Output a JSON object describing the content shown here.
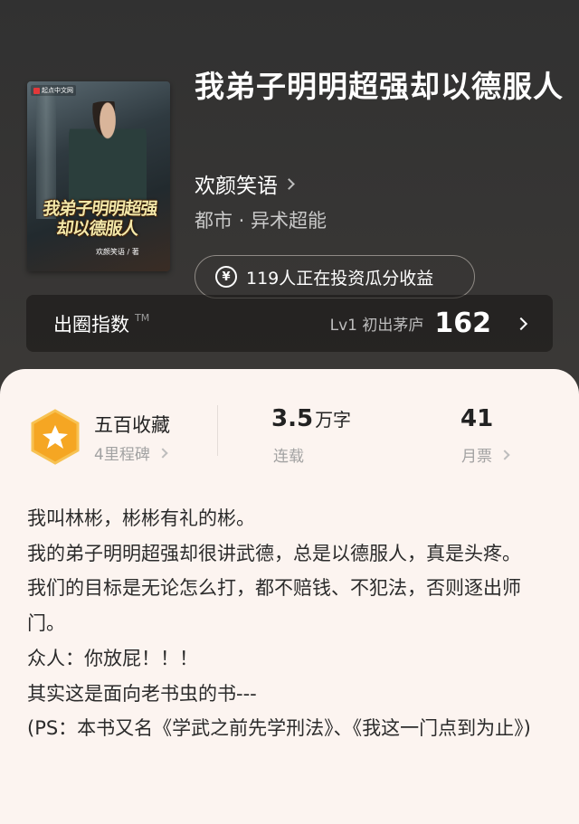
{
  "cover": {
    "publisher_tag": "起点中文网",
    "title_line1": "我弟子明明超强",
    "title_line2": "却以德服人",
    "author_mark": "欢颜笑语 / 著"
  },
  "book": {
    "title": "我弟子明明超强却以德服人",
    "author": "欢颜笑语",
    "genre": "都市 · 异术超能",
    "invest_text": "119人正在投资瓜分收益",
    "yen_symbol": "¥"
  },
  "influence": {
    "label": "出圈指数",
    "tm": "TM",
    "level": "Lv1 初出茅庐",
    "score": "162"
  },
  "stats": {
    "milestone_title": "五百收藏",
    "milestone_sub": "4里程碑",
    "words_value": "3.5",
    "words_unit": "万字",
    "status": "连载",
    "monthly_votes": "41",
    "monthly_label": "月票"
  },
  "intro": [
    "我叫林彬，彬彬有礼的彬。",
    "我的弟子明明超强却很讲武德，总是以德服人，真是头疼。",
    "我们的目标是无论怎么打，都不赔钱、不犯法，否则逐出师门。",
    "众人：你放屁！！！",
    "其实这是面向老书虫的书---",
    "(PS：本书又名《学武之前先学刑法》、《我这一门点到为止》)"
  ],
  "colors": {
    "header_bg": "#333232",
    "card_bg": "#fcf4f0",
    "badge_orange": "#f5a623"
  }
}
